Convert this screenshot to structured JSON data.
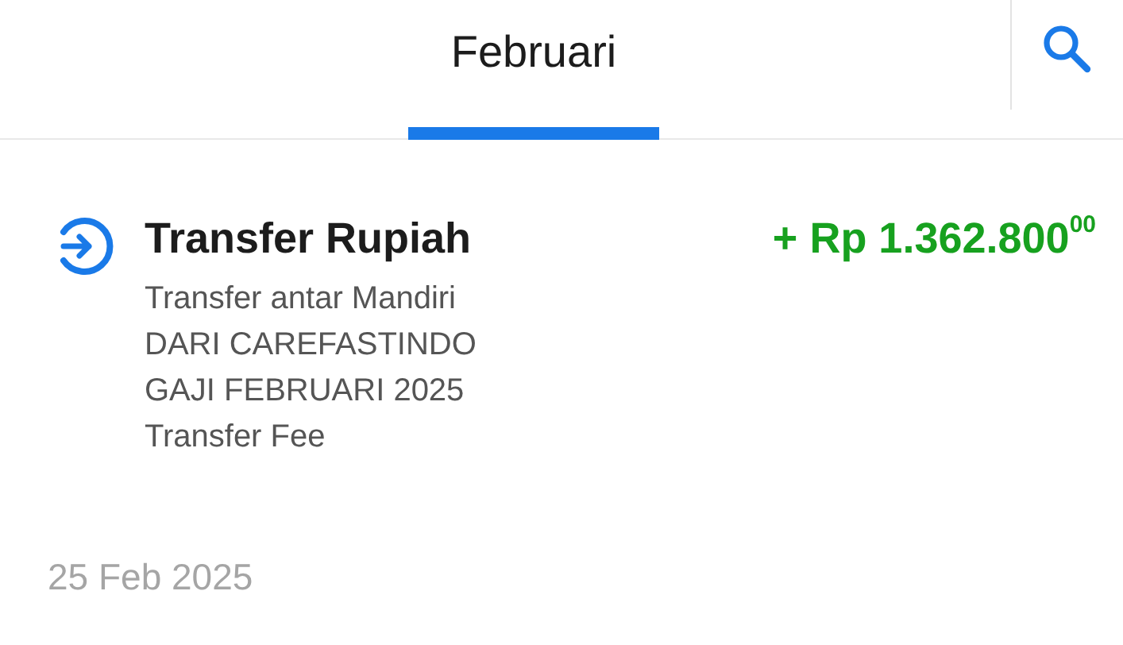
{
  "tabs": [
    {
      "label": "Februari",
      "selected": true
    }
  ],
  "transactions": [
    {
      "title": "Transfer Rupiah",
      "amount": "+ Rp 1.362.800$^{00}$",
      "details": [
        "Transfer antar Mandiri",
        "DARI CAREFASTINDO",
        "GAJI FEBRUARI 2025",
        "Transfer Fee"
      ],
      "date": "25 Feb 2025"
    }
  ]
}
